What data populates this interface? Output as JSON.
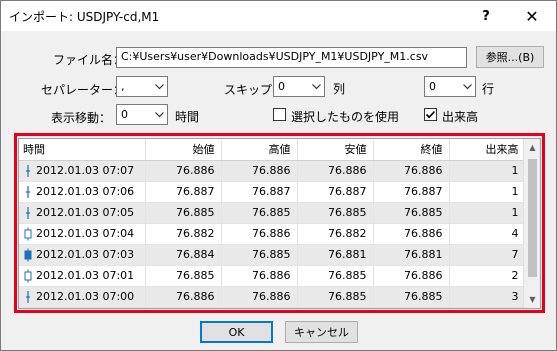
{
  "window": {
    "title": "インポート: USDJPY-cd,M1",
    "help_label": "?",
    "close_label": "✕"
  },
  "file": {
    "label": "ファイル名：",
    "path": "C:¥Users¥user¥Downloads¥USDJPY_M1¥USDJPY_M1.csv",
    "browse_label": "参照...(B)"
  },
  "separator": {
    "label": "セパレーター：",
    "value": ","
  },
  "skip": {
    "label": "スキップ：",
    "columns_value": "0",
    "columns_unit": "列",
    "rows_value": "0",
    "rows_unit": "行"
  },
  "offset": {
    "label": "表示移動：",
    "value": "0",
    "unit": "時間"
  },
  "options": {
    "use_selected_label": "選択したものを使用",
    "use_selected_checked": false,
    "volume_label": "出来高",
    "volume_checked": true
  },
  "grid": {
    "columns": [
      "時間",
      "始値",
      "高値",
      "安値",
      "終値",
      "出来高"
    ],
    "rows": [
      {
        "icon": "dash-icon",
        "time": "2012.01.03 07:07",
        "open": "76.886",
        "high": "76.886",
        "low": "76.886",
        "close": "76.886",
        "volume": "1"
      },
      {
        "icon": "dash-icon",
        "time": "2012.01.03 07:06",
        "open": "76.887",
        "high": "76.887",
        "low": "76.887",
        "close": "76.887",
        "volume": "1"
      },
      {
        "icon": "dash-icon",
        "time": "2012.01.03 07:05",
        "open": "76.885",
        "high": "76.885",
        "low": "76.885",
        "close": "76.885",
        "volume": "1"
      },
      {
        "icon": "hollow-candle-icon",
        "time": "2012.01.03 07:04",
        "open": "76.882",
        "high": "76.886",
        "low": "76.882",
        "close": "76.886",
        "volume": "4"
      },
      {
        "icon": "filled-candle-icon",
        "time": "2012.01.03 07:03",
        "open": "76.884",
        "high": "76.885",
        "low": "76.881",
        "close": "76.881",
        "volume": "7"
      },
      {
        "icon": "hollow-candle-icon",
        "time": "2012.01.03 07:01",
        "open": "76.885",
        "high": "76.886",
        "low": "76.885",
        "close": "76.886",
        "volume": "2"
      },
      {
        "icon": "dash-icon",
        "time": "2012.01.03 07:00",
        "open": "76.886",
        "high": "76.886",
        "low": "76.885",
        "close": "76.885",
        "volume": "3"
      }
    ]
  },
  "footer": {
    "ok_label": "OK",
    "cancel_label": "キャンセル"
  },
  "colors": {
    "highlight_frame": "#e4001b",
    "alt_row": "#e9e9e9",
    "candle_blue": "#1f6fbf"
  }
}
